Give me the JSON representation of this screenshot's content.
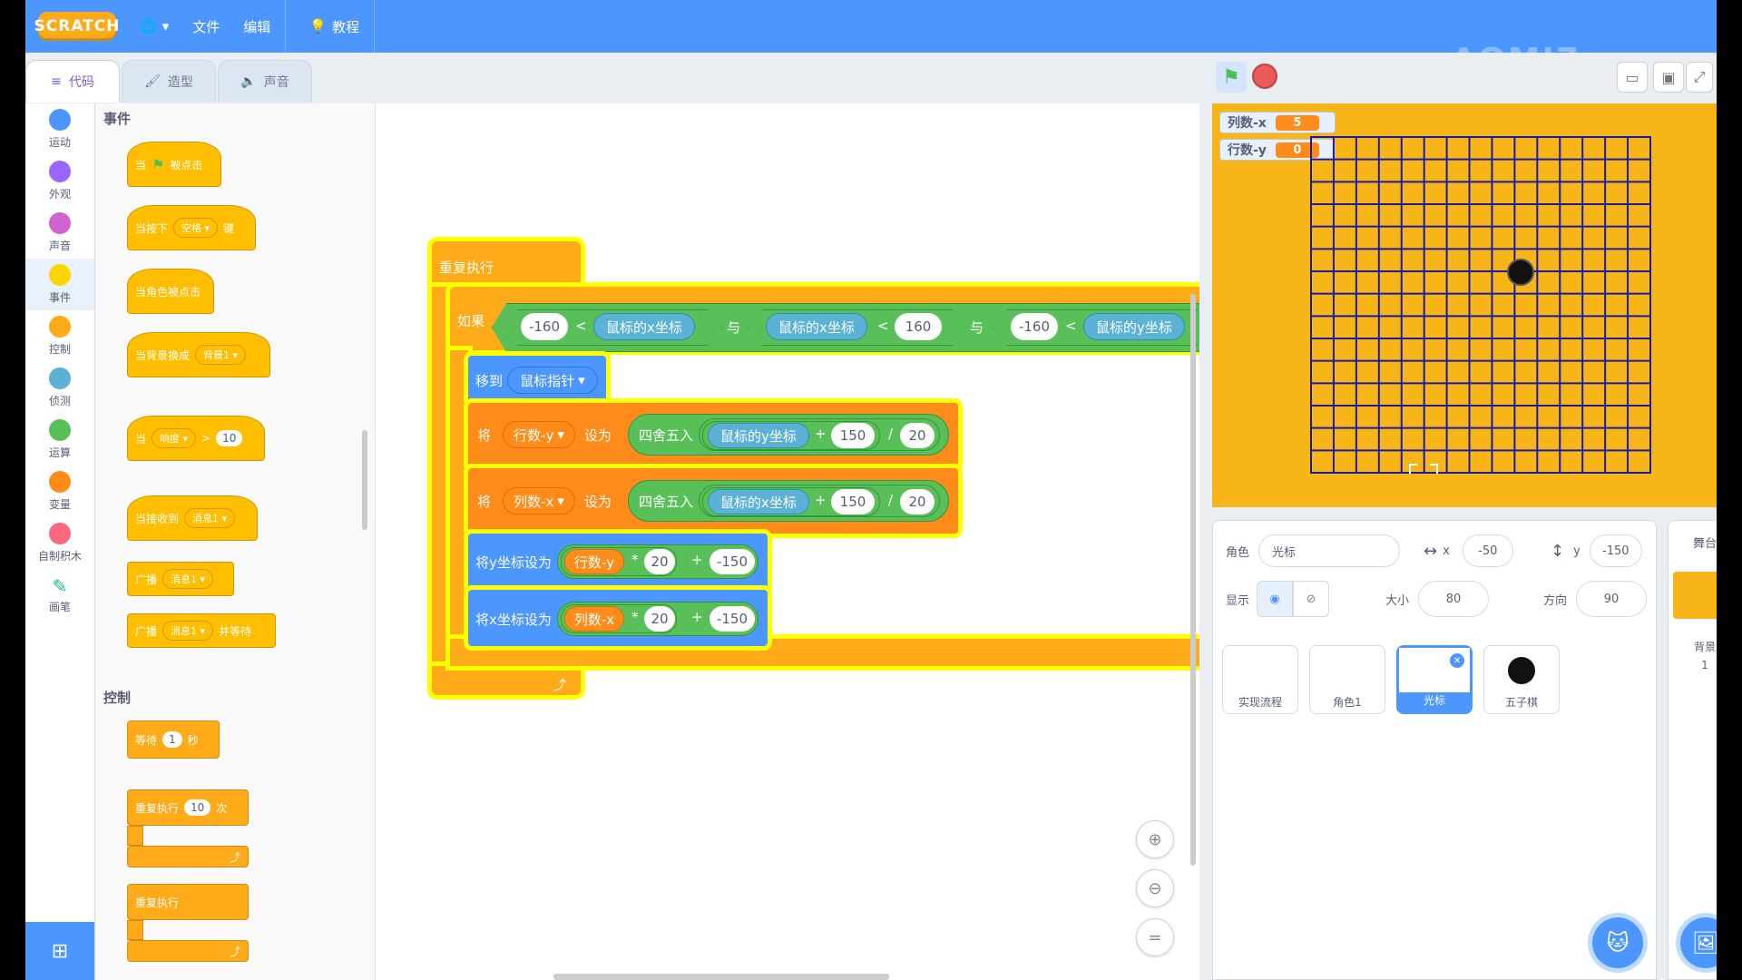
{
  "menu": {
    "logo": "SCRATCH",
    "file": "文件",
    "edit": "编辑",
    "tutorials": "教程"
  },
  "watermark": "AOMI7",
  "tabs": {
    "code": "代码",
    "costumes": "造型",
    "sounds": "声音"
  },
  "categories": [
    {
      "label": "运动",
      "color": "#4c97ff"
    },
    {
      "label": "外观",
      "color": "#9966ff"
    },
    {
      "label": "声音",
      "color": "#cf63cf"
    },
    {
      "label": "事件",
      "color": "#ffd500"
    },
    {
      "label": "控制",
      "color": "#ffab19"
    },
    {
      "label": "侦测",
      "color": "#5cb1d6"
    },
    {
      "label": "运算",
      "color": "#59c059"
    },
    {
      "label": "变量",
      "color": "#ff8c1a"
    },
    {
      "label": "自制积木",
      "color": "#ff6680"
    },
    {
      "label": "画笔",
      "color": "#0fbd8c"
    }
  ],
  "palette": {
    "events_heading": "事件",
    "when_flag_prefix": "当",
    "when_flag_suffix": "被点击",
    "when_key_prefix": "当按下",
    "when_key_dd": "空格",
    "when_key_suffix": "键",
    "when_sprite_clicked": "当角色被点击",
    "when_backdrop_prefix": "当背景换成",
    "when_backdrop_dd": "背景1",
    "when_gt_prefix": "当",
    "when_gt_dd": "响度",
    "when_gt_op": ">",
    "when_gt_val": "10",
    "when_receive_prefix": "当接收到",
    "when_receive_dd": "消息1",
    "broadcast_prefix": "广播",
    "broadcast_dd": "消息1",
    "broadcast_wait_prefix": "广播",
    "broadcast_wait_dd": "消息1",
    "broadcast_wait_suffix": "并等待",
    "control_heading": "控制",
    "wait_prefix": "等待",
    "wait_val": "1",
    "wait_suffix": "秒",
    "repeat_prefix": "重复执行",
    "repeat_val": "10",
    "repeat_suffix": "次",
    "forever": "重复执行"
  },
  "script": {
    "forever": "重复执行",
    "if": "如果",
    "and": "与",
    "lt": "<",
    "c1_left": "-160",
    "c1_right": "鼠标的x坐标",
    "c2_left": "鼠标的x坐标",
    "c2_right": "160",
    "c3_left": "-160",
    "c3_right": "鼠标的y坐标",
    "goto": "移到",
    "goto_dd": "鼠标指针",
    "set_word": "将",
    "to_word": "设为",
    "var_y": "行数-y",
    "var_x": "列数-x",
    "round": "四舍五入",
    "mouse_y": "鼠标的y坐标",
    "mouse_x": "鼠标的x坐标",
    "plus": "+",
    "div": "/",
    "times": "*",
    "n150": "150",
    "n20": "20",
    "setY": "将y坐标设为",
    "setX": "将x坐标设为",
    "neg150": "-150",
    "loop_arrow": "⤴"
  },
  "monitors": {
    "col_label": "列数-x",
    "col_val": "5",
    "row_label": "行数-y",
    "row_val": "0"
  },
  "sprite_info": {
    "sprite_label": "角色",
    "sprite_name": "光标",
    "x_label": "x",
    "x_val": "-50",
    "y_label": "y",
    "y_val": "-150",
    "show_label": "显示",
    "size_label": "大小",
    "size_val": "80",
    "dir_label": "方向",
    "dir_val": "90"
  },
  "sprites": [
    "实现流程",
    "角色1",
    "光标",
    "五子棋"
  ],
  "stage_target": {
    "heading": "舞台",
    "backdrops_label": "背景",
    "backdrops_count": "1"
  },
  "colors": {
    "menubar": "#4c97ff",
    "stage_bg": "#f7b518",
    "grid": "#1a1aa8"
  }
}
